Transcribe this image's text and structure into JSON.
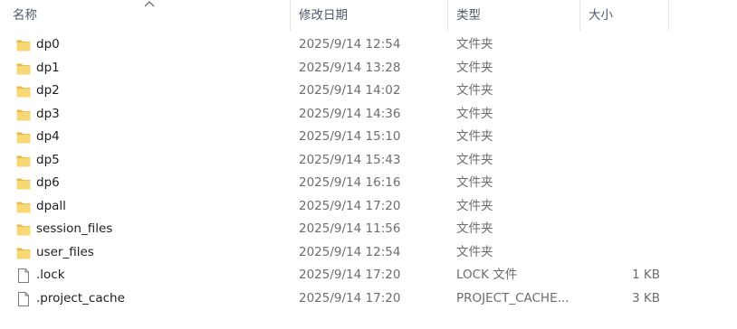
{
  "columns": {
    "name": "名称",
    "modified": "修改日期",
    "type": "类型",
    "size": "大小"
  },
  "sort": {
    "column": "name",
    "direction": "ascending",
    "icon": "sort-up-chevron-icon"
  },
  "colors": {
    "folder": "#F8D775",
    "folder_dark": "#E8B84A",
    "file_outline": "#7a7a7a"
  },
  "files": [
    {
      "name": "dp0",
      "modified": "2025/9/14 12:54",
      "type": "文件夹",
      "size": "",
      "icon": "folder-icon"
    },
    {
      "name": "dp1",
      "modified": "2025/9/14 13:28",
      "type": "文件夹",
      "size": "",
      "icon": "folder-icon"
    },
    {
      "name": "dp2",
      "modified": "2025/9/14 14:02",
      "type": "文件夹",
      "size": "",
      "icon": "folder-icon"
    },
    {
      "name": "dp3",
      "modified": "2025/9/14 14:36",
      "type": "文件夹",
      "size": "",
      "icon": "folder-icon"
    },
    {
      "name": "dp4",
      "modified": "2025/9/14 15:10",
      "type": "文件夹",
      "size": "",
      "icon": "folder-icon"
    },
    {
      "name": "dp5",
      "modified": "2025/9/14 15:43",
      "type": "文件夹",
      "size": "",
      "icon": "folder-icon"
    },
    {
      "name": "dp6",
      "modified": "2025/9/14 16:16",
      "type": "文件夹",
      "size": "",
      "icon": "folder-icon"
    },
    {
      "name": "dpall",
      "modified": "2025/9/14 17:20",
      "type": "文件夹",
      "size": "",
      "icon": "folder-icon"
    },
    {
      "name": "session_files",
      "modified": "2025/9/14 11:56",
      "type": "文件夹",
      "size": "",
      "icon": "folder-icon"
    },
    {
      "name": "user_files",
      "modified": "2025/9/14 12:54",
      "type": "文件夹",
      "size": "",
      "icon": "folder-icon"
    },
    {
      "name": ".lock",
      "modified": "2025/9/14 17:20",
      "type": "LOCK 文件",
      "size": "1 KB",
      "icon": "file-icon"
    },
    {
      "name": ".project_cache",
      "modified": "2025/9/14 17:20",
      "type": "PROJECT_CACHE...",
      "size": "3 KB",
      "icon": "file-icon"
    }
  ]
}
